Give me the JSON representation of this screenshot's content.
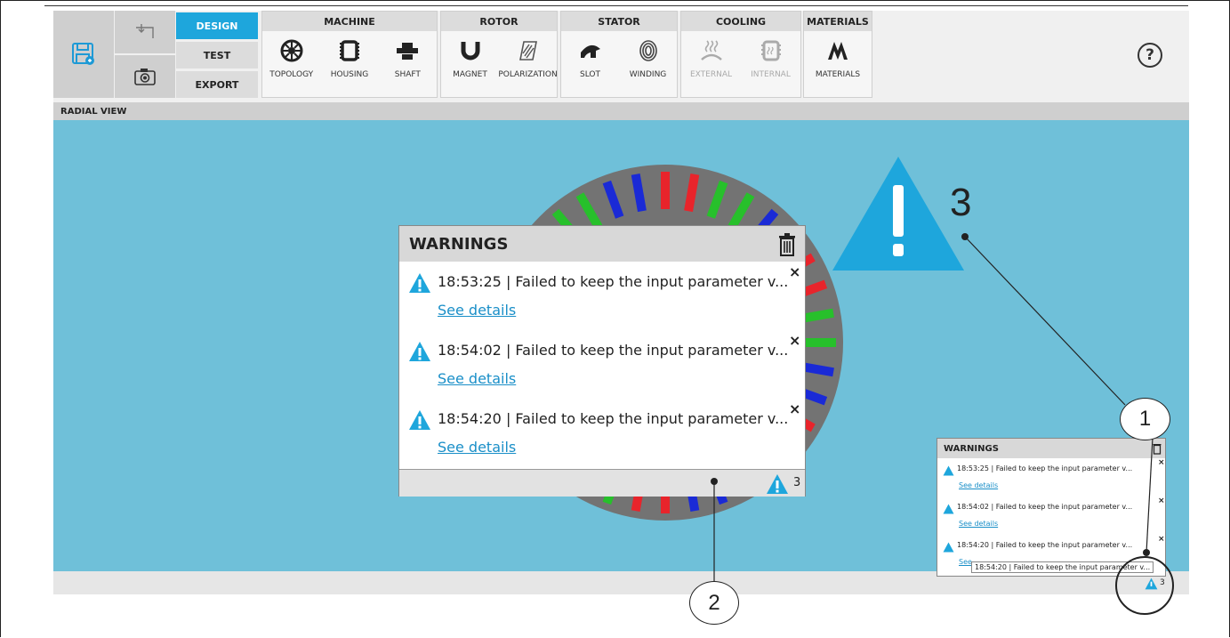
{
  "modes": {
    "design": "DESIGN",
    "test": "TEST",
    "export": "EXPORT"
  },
  "groups": {
    "machine": {
      "title": "MACHINE",
      "items": [
        "TOPOLOGY",
        "HOUSING",
        "SHAFT"
      ]
    },
    "rotor": {
      "title": "ROTOR",
      "items": [
        "MAGNET",
        "POLARIZATION"
      ]
    },
    "stator": {
      "title": "STATOR",
      "items": [
        "SLOT",
        "WINDING"
      ]
    },
    "cooling": {
      "title": "COOLING",
      "items": [
        "EXTERNAL",
        "INTERNAL"
      ]
    },
    "materials": {
      "title": "MATERIALS",
      "items": [
        "MATERIALS"
      ]
    }
  },
  "help_icon": "?",
  "view_title": "RADIAL VIEW",
  "big_warning_count": "3",
  "warnings_panel": {
    "title": "WARNINGS",
    "items": [
      {
        "text": "18:53:25 | Failed to keep the input parameter v...",
        "link": "See details"
      },
      {
        "text": "18:54:02 | Failed to keep the input parameter v...",
        "link": "See details"
      },
      {
        "text": "18:54:20 | Failed to keep the input parameter v...",
        "link": "See details"
      }
    ],
    "close_glyph": "×",
    "count": "3"
  },
  "small_panel": {
    "title": "WARNINGS",
    "items": [
      {
        "text": "18:53:25 | Failed to keep the input parameter v...",
        "link": "See details"
      },
      {
        "text": "18:54:02 | Failed to keep the input parameter v...",
        "link": "See details"
      },
      {
        "text": "18:54:20 | Failed to keep the input parameter v...",
        "link": "See"
      }
    ],
    "tooltip": "18:54:20 | Failed to keep the input parameter v...",
    "count": "3"
  },
  "callouts": [
    "1",
    "2"
  ],
  "colors": {
    "accent": "#1ea6dc",
    "canvas": "#6fc0d9",
    "warning": "#1ea6dc",
    "link": "#1a8fc8"
  }
}
